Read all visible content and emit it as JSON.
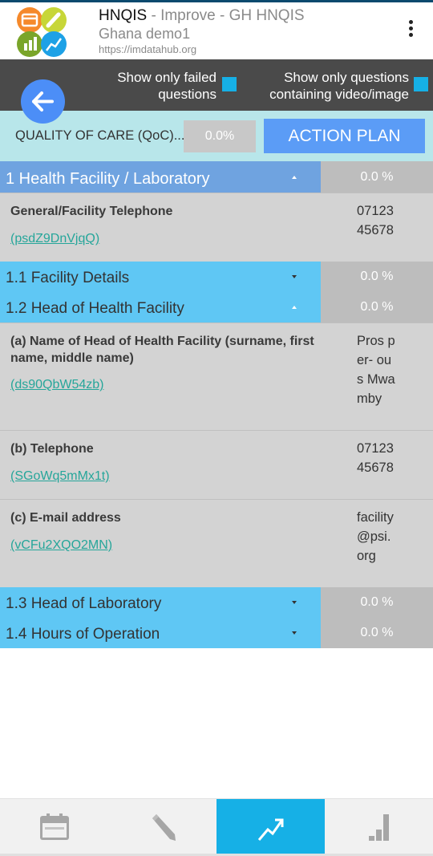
{
  "header": {
    "app_name": "HNQIS",
    "program": " - Improve - GH HNQIS",
    "org_unit": "Ghana demo1",
    "server_url": "https://imdatahub.org",
    "logo_icon": "hnqis-logo-icon",
    "menu_icon": "more-vert-icon"
  },
  "filters": {
    "failed_label": "Show only failed questions",
    "media_label": "Show only questions containing video/image",
    "back_icon": "arrow-left-icon"
  },
  "quality": {
    "label": "QUALITY OF CARE (QoC)...",
    "value": "0.0%",
    "action_plan_label": "ACTION PLAN"
  },
  "sections": [
    {
      "title": "1 Health Facility / Laboratory",
      "score": "0.0 %"
    },
    {
      "title": "1.1 Facility Details",
      "score": "0.0 %"
    },
    {
      "title": "1.2 Head of Health Facility",
      "score": "0.0 %"
    },
    {
      "title": "1.3 Head of Laboratory",
      "score": "0.0 %"
    },
    {
      "title": "1.4 Hours of Operation",
      "score": "0.0 %"
    }
  ],
  "questions": [
    {
      "label": "General/Facility Telephone",
      "code": "(psdZ9DnVjqQ)",
      "answer": "0712345678"
    },
    {
      "label": "(a) Name of Head of Health Facility (surname, first name, middle name)",
      "code": "(ds90QbW54zb)",
      "answer": "Pros per- ous Mwa mby"
    },
    {
      "label": "(b) Telephone",
      "code": "(SGoWq5mMx1t)",
      "answer": "0712345678"
    },
    {
      "label": "(c) E-mail address",
      "code": "(vCFu2XQO2MN)",
      "answer": "facility@psi.org"
    }
  ],
  "colors": {
    "section_main": "#6fa3e0",
    "section_sub": "#5fc7f4",
    "score_bg": "#bdbdbd",
    "question_bg": "#d3d3d3",
    "code_link": "#26a69a",
    "accent_blue": "#16b0e6",
    "action_button": "#5b9cf6",
    "qoc_bar": "#b8e6ea",
    "filter_bar": "#4a4a4a"
  },
  "nav": {
    "items": [
      {
        "icon": "calendar-icon",
        "active": false
      },
      {
        "icon": "pencil-icon",
        "active": false
      },
      {
        "icon": "trend-chart-icon",
        "active": true
      },
      {
        "icon": "bar-chart-icon",
        "active": false
      }
    ]
  }
}
